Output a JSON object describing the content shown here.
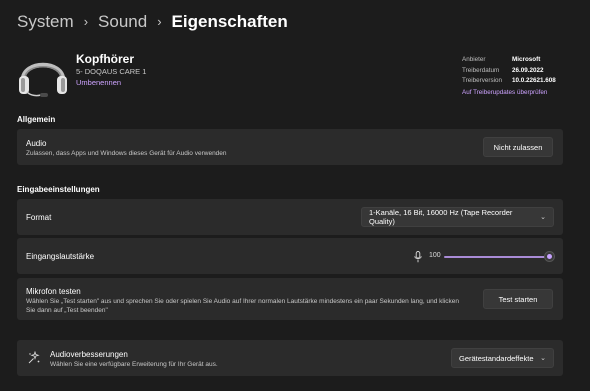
{
  "breadcrumb": {
    "items": [
      "System",
      "Sound"
    ],
    "current": "Eigenschaften",
    "separator": "›"
  },
  "device": {
    "name": "Kopfhörer",
    "model": "5- DOQAUS CARE 1",
    "rename_label": "Umbenennen"
  },
  "driver": {
    "provider_key": "Anbieter",
    "provider_val": "Microsoft",
    "date_key": "Treiberdatum",
    "date_val": "26.09.2022",
    "version_key": "Treiberversion",
    "version_val": "10.0.22621.608",
    "update_link": "Auf Treiberupdates überprüfen"
  },
  "sections": {
    "general": "Allgemein",
    "input": "Eingabeeinstellungen"
  },
  "audio": {
    "title": "Audio",
    "description": "Zulassen, dass Apps und Windows dieses Gerät für Audio verwenden",
    "button_label": "Nicht zulassen"
  },
  "format": {
    "title": "Format",
    "selected": "1-Kanäle, 16 Bit, 16000 Hz (Tape Recorder Quality)"
  },
  "volume": {
    "title": "Eingangslautstärke",
    "value": "100",
    "level_percent": 100
  },
  "mic_test": {
    "title": "Mikrofon testen",
    "description_line1": "Wählen Sie „Test starten\" aus und sprechen Sie oder spielen Sie Audio auf Ihrer normalen Lautstärke mindestens ein paar Sekunden lang, und klicken",
    "description_line2": "Sie dann auf „Test beenden\"",
    "button_label": "Test starten"
  },
  "enhancements": {
    "title": "Audioverbesserungen",
    "description": "Wählen Sie eine verfügbare Erweiterung für Ihr Gerät aus.",
    "selected": "Gerätestandardeffekte"
  },
  "colors": {
    "background": "#1c1c1c",
    "card": "#2b2b2b",
    "accent": "#c7a2ff",
    "link": "#cda3ff"
  }
}
